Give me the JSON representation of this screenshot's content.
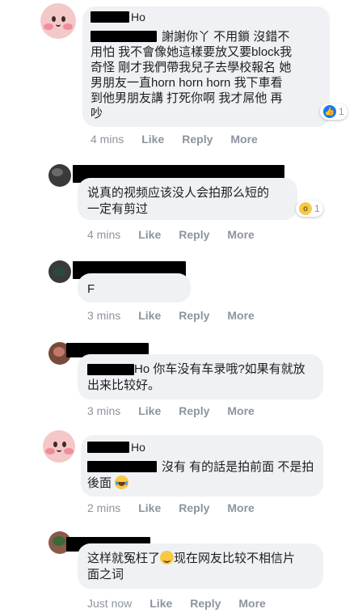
{
  "comments": [
    {
      "author_suffix": "Ho",
      "lines": [
        "謝謝你丫 不用鎖 沒錯不",
        "用怕 我不會像她這樣要放又要block我",
        "奇怪 剛才我們帶我兒子去學校報名 她",
        "男朋友一直horn horn horn 我下車看",
        "到他男朋友講 打死你啊 我才屌他 再",
        "吵"
      ],
      "time": "4 mins",
      "like": "Like",
      "reply": "Reply",
      "more": "More",
      "reaction": {
        "icon": "like-icon",
        "count": "1"
      }
    },
    {
      "author_suffix": "",
      "lines": [
        "说真的视频应该没人会拍那么短的",
        "一定有剪过"
      ],
      "time": "4 mins",
      "like": "Like",
      "reply": "Reply",
      "more": "More",
      "reaction": {
        "icon": "wow-icon",
        "count": "1"
      }
    },
    {
      "author_suffix": "",
      "lines": [
        "F"
      ],
      "time": "3 mins",
      "like": "Like",
      "reply": "Reply",
      "more": "More"
    },
    {
      "author_suffix": "",
      "lines": [
        "Ho 你车没有车录哦?如果有就放",
        "出来比较好。"
      ],
      "time": "3 mins",
      "like": "Like",
      "reply": "Reply",
      "more": "More"
    },
    {
      "author_suffix": "Ho",
      "lines": [
        "沒有 有的話是拍前面 不是拍",
        "後面"
      ],
      "time": "2 mins",
      "like": "Like",
      "reply": "Reply",
      "more": "More"
    },
    {
      "author_suffix": "",
      "lines_parts": [
        "这样就冤枉了",
        "现在网友比较不相信片",
        "面之词"
      ],
      "time": "Just now",
      "like": "Like",
      "reply": "Reply",
      "more": "More"
    }
  ],
  "colors": {
    "bubble": "#f0f1f4",
    "meta": "#8d949e",
    "like_blue": "#1877f2"
  }
}
